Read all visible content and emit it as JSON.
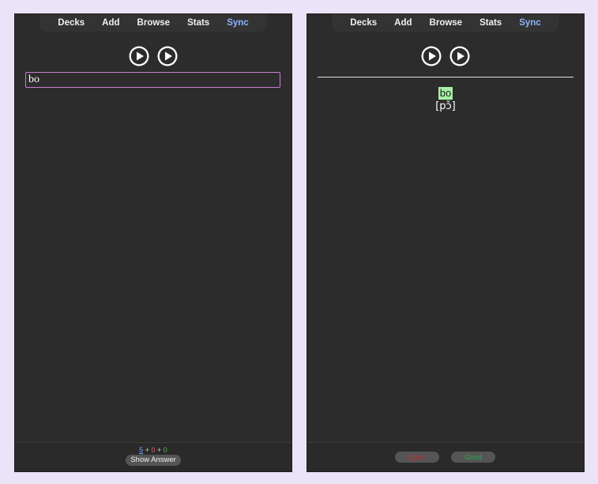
{
  "nav": {
    "decks": "Decks",
    "add": "Add",
    "browse": "Browse",
    "stats": "Stats",
    "sync": "Sync"
  },
  "question": {
    "typed_answer": "bo"
  },
  "counts": {
    "new": "5",
    "learning": "0",
    "review": "0",
    "separator": "+"
  },
  "buttons": {
    "show_answer": "Show Answer",
    "again": "Again",
    "good": "Good"
  },
  "answer": {
    "word": "bo",
    "ipa": "[pɔ̌]"
  },
  "icons": {
    "play": "play-circle-icon"
  },
  "colors": {
    "sync": "#8ab4ff",
    "input_border": "#c97fd0",
    "answer_highlight": "#a6f0a6",
    "again": "#e02020",
    "good": "#2aa84a"
  }
}
